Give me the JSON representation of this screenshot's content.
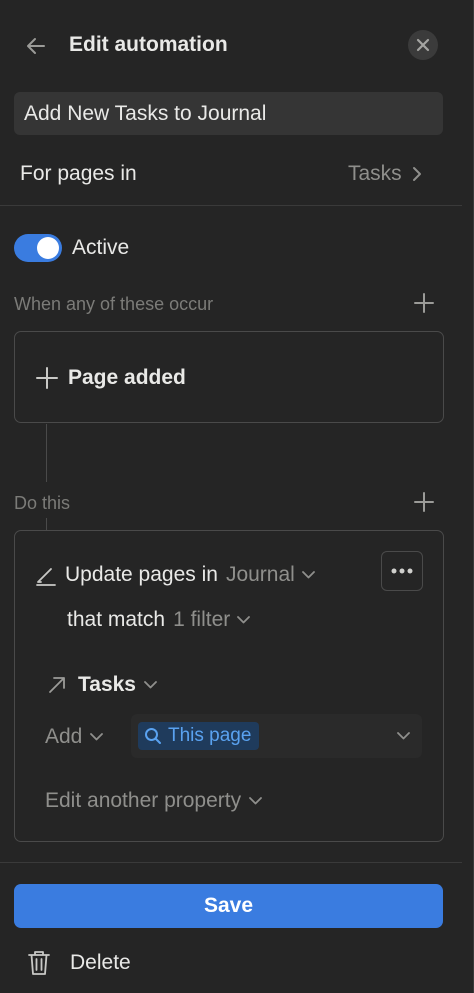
{
  "header": {
    "title": "Edit automation",
    "back_icon": "arrow-left-icon",
    "close_icon": "close-icon"
  },
  "automation_name": "Add New Tasks to Journal",
  "for_pages": {
    "label": "For pages in",
    "value": "Tasks"
  },
  "active": {
    "label": "Active",
    "on": true,
    "color": "#3a7ce0"
  },
  "triggers": {
    "label": "When any of these occur",
    "items": [
      {
        "label": "Page added"
      }
    ]
  },
  "actions": {
    "label": "Do this",
    "update": {
      "verb": "Update pages in",
      "database": "Journal",
      "match_label": "that match",
      "filter_count": "1 filter"
    },
    "property": {
      "name": "Tasks",
      "mode": "Add",
      "value": "This page"
    },
    "edit_another": "Edit another property"
  },
  "footer": {
    "save_label": "Save",
    "delete_label": "Delete",
    "save_color": "#3a7ce0"
  }
}
